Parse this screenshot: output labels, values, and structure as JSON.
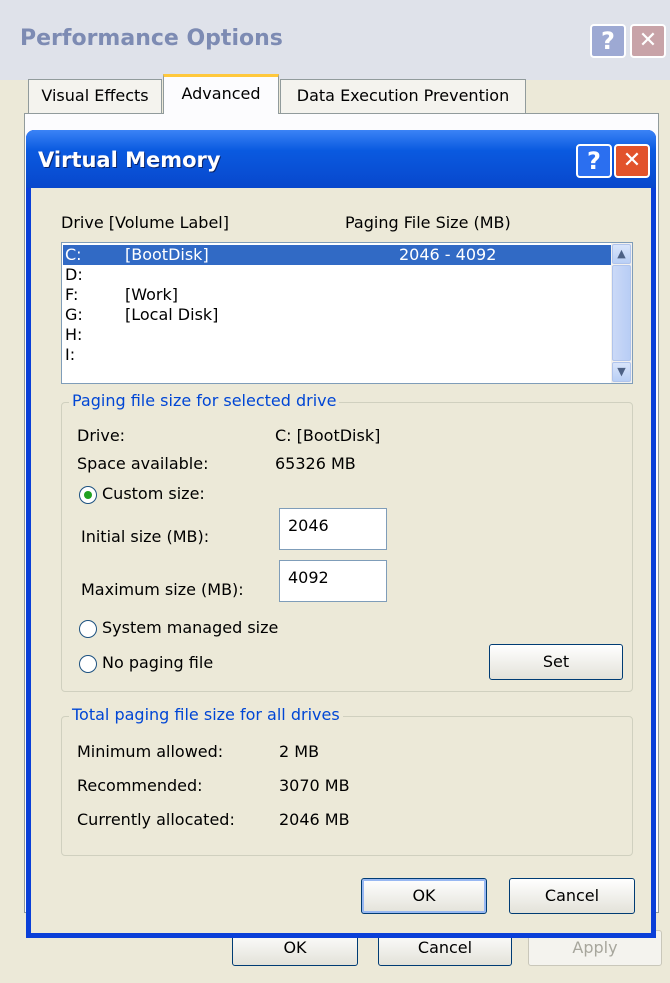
{
  "perf_window": {
    "title": "Performance Options",
    "help_glyph": "?",
    "close_glyph": "✕",
    "tabs": [
      "Visual Effects",
      "Advanced",
      "Data Execution Prevention"
    ],
    "ok_label": "OK",
    "cancel_label": "Cancel",
    "apply_label": "Apply"
  },
  "dialog": {
    "title": "Virtual Memory",
    "help_glyph": "?",
    "close_glyph": "✕",
    "list_headers": {
      "drive": "Drive  [Volume Label]",
      "paging": "Paging File Size (MB)"
    },
    "drives": [
      {
        "letter": "C:",
        "label": "[BootDisk]",
        "paging": "2046 - 4092",
        "selected": true
      },
      {
        "letter": "D:",
        "label": "",
        "paging": ""
      },
      {
        "letter": "F:",
        "label": "[Work]",
        "paging": ""
      },
      {
        "letter": "G:",
        "label": "[Local Disk]",
        "paging": ""
      },
      {
        "letter": "H:",
        "label": "",
        "paging": ""
      },
      {
        "letter": "I:",
        "label": "",
        "paging": ""
      }
    ],
    "selected_group": {
      "title": "Paging file size for selected drive",
      "drive_label": "Drive:",
      "drive_value": "C:  [BootDisk]",
      "space_label": "Space available:",
      "space_value": "65326 MB",
      "custom_label": "Custom size:",
      "initial_label": "Initial size (MB):",
      "initial_value": "2046",
      "maximum_label": "Maximum size (MB):",
      "maximum_value": "4092",
      "system_managed_label": "System managed size",
      "no_paging_label": "No paging file",
      "set_label": "Set",
      "selected_option": "custom"
    },
    "total_group": {
      "title": "Total paging file size for all drives",
      "min_label": "Minimum allowed:",
      "min_value": "2 MB",
      "recommended_label": "Recommended:",
      "recommended_value": "3070 MB",
      "allocated_label": "Currently allocated:",
      "allocated_value": "2046 MB"
    },
    "ok_label": "OK",
    "cancel_label": "Cancel"
  },
  "colors": {
    "titlebar_blue": "#0a5ae0",
    "selection": "#316ac5",
    "group_title": "#0046d5",
    "dialog_face": "#ece9d8"
  }
}
